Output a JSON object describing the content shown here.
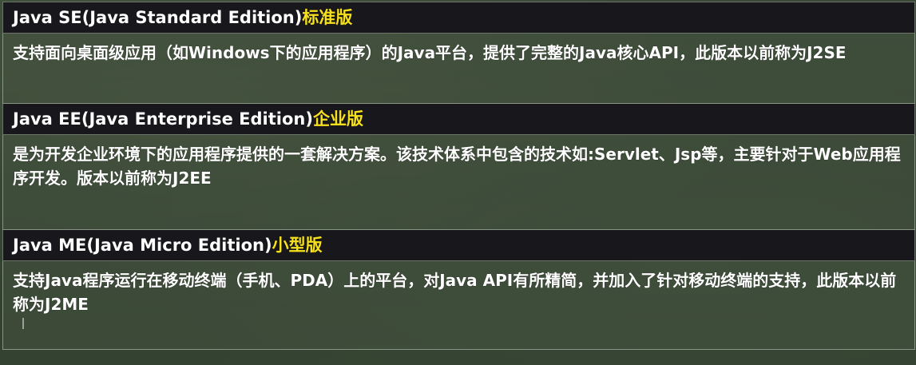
{
  "editions": [
    {
      "title": "Java SE(Java Standard Edition)",
      "tag": "标准版",
      "description": "支持面向桌面级应用（如Windows下的应用程序）的Java平台，提供了完整的Java核心API，此版本以前称为J2SE"
    },
    {
      "title": "Java EE(Java Enterprise Edition)",
      "tag": "企业版",
      "description": "是为开发企业环境下的应用程序提供的一套解决方案。该技术体系中包含的技术如:Servlet、Jsp等，主要针对于Web应用程序开发。版本以前称为J2EE"
    },
    {
      "title": "Java ME(Java Micro Edition)",
      "tag": "小型版",
      "description": "支持Java程序运行在移动终端（手机、PDA）上的平台，对Java API有所精简，并加入了针对移动终端的支持，此版本以前称为J2ME"
    }
  ],
  "colors": {
    "tag": "#f7e11b",
    "header_bg": "#18181c",
    "text": "#ffffff"
  }
}
